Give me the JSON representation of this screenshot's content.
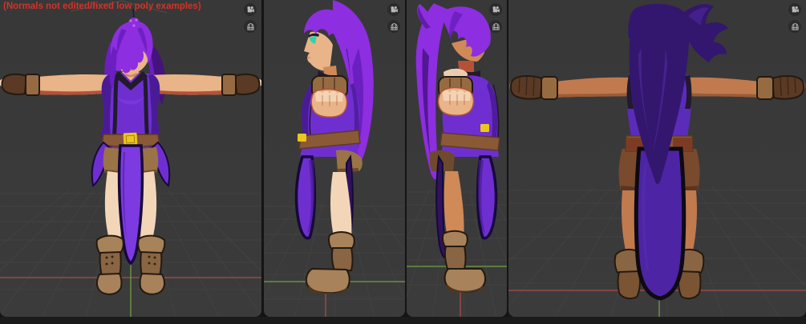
{
  "annotation": {
    "text": "(Normals not edited/fixed low poly examples)",
    "color": "#d0332a"
  },
  "panels": [
    {
      "name": "viewport-front",
      "view": "front"
    },
    {
      "name": "viewport-side-left",
      "view": "side-facing-left"
    },
    {
      "name": "viewport-side-right",
      "view": "side-facing-right"
    },
    {
      "name": "viewport-back",
      "view": "back"
    }
  ],
  "gizmo_icons": [
    {
      "name": "camera-view-icon"
    },
    {
      "name": "perspective-grid-icon"
    }
  ],
  "colors": {
    "window_bg": "#141414",
    "panel_bg": "#3b3b3b",
    "panel_bg_top": "#383838",
    "bottom_bar": "#1b1b1b",
    "grid_line": "#484848",
    "axis_x": "#b04a4a",
    "axis_y": "#6fa045",
    "annotation": "#d0332a",
    "icon_bg": "#2b2b2b",
    "icon_fg": "#b8b8b8",
    "hair_hi": "#8d2ee0",
    "hair_mid": "#6b1fc0",
    "hair_dark": "#45127e",
    "hair_back": "#33176e",
    "hair_back_hi": "#4b2596",
    "skin": "#e9b488",
    "skin_hi": "#f3d6b8",
    "skin_shade": "#cf8a58",
    "skin_line": "#b45238",
    "skin_back": "#c07a4e",
    "skin_back_shade": "#9c5c38",
    "eye": "#2fd3a8",
    "outfit": "#6f2fd0",
    "outfit_hi": "#7d3ae0",
    "outfit_dark": "#4a1b96",
    "outfit_deep": "#31125e",
    "outfit_back": "#5b2bba",
    "outfit_line": "#16093a",
    "trim": "#221a2e",
    "belt": "#8a5a36",
    "belt_dark": "#5e3a22",
    "buckle": "#ecc51f",
    "band": "#966b42",
    "glove": "#5a3a24",
    "shorts": "#9a7347",
    "shorts_dark": "#6e4a2c",
    "shorts_back": "#7a4a2c",
    "boot": "#a8825a",
    "boot_mid": "#8a6544",
    "boot_back": "#7a5433",
    "sole": "#55391f",
    "cloth": "#4d24a4",
    "cloth_line": "#0d0a14",
    "pouch": "#7c3c24",
    "outline": "#241a10"
  }
}
